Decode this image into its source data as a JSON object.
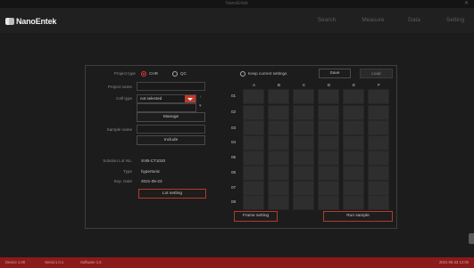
{
  "window": {
    "title": "NanoEntek",
    "close": "✕"
  },
  "app": {
    "name": "NanoEntek",
    "tabs": [
      {
        "label": "Search"
      },
      {
        "label": "Measure"
      },
      {
        "label": "Data"
      },
      {
        "label": "Setting"
      }
    ]
  },
  "form": {
    "project_type_label": "Project type",
    "options": [
      {
        "label": "CHR",
        "selected": true
      },
      {
        "label": "QC",
        "selected": false
      }
    ],
    "project_name_label": "Project name",
    "project_name_value": "",
    "cell_type_label": "Cell type",
    "cell_type_value": "not selected",
    "manage_button": "Manage",
    "sample_name_label": "Sample name",
    "sample_name_value": "",
    "include_button": "Include",
    "solution_lot_label": "Solution Lot No.",
    "solution_lot_value": "SVB-CT1020",
    "type_label": "Type",
    "type_value": "hypertonic",
    "exp_date_label": "Exp. Date",
    "exp_date_value": "2021-05-23",
    "lot_setting_button": "Lot setting"
  },
  "plate": {
    "keep_current_label": "Keep current settings",
    "save_button": "Save",
    "load_button": "Load",
    "columns": [
      "A",
      "B",
      "C",
      "D",
      "E",
      "F"
    ],
    "rows": [
      "01",
      "02",
      "03",
      "04",
      "05",
      "06",
      "07",
      "08"
    ],
    "frame_setting_button": "Frame setting",
    "run_sample_button": "Run sample"
  },
  "statusbar": {
    "items": [
      "Device 1.00",
      "Serial 1.0.1",
      "Software 1.0"
    ],
    "right": "2021-05-23 12:00"
  },
  "colors": {
    "accent": "#e53935",
    "statusbar": "#8b1a1a",
    "background": "#1c1c1c"
  }
}
